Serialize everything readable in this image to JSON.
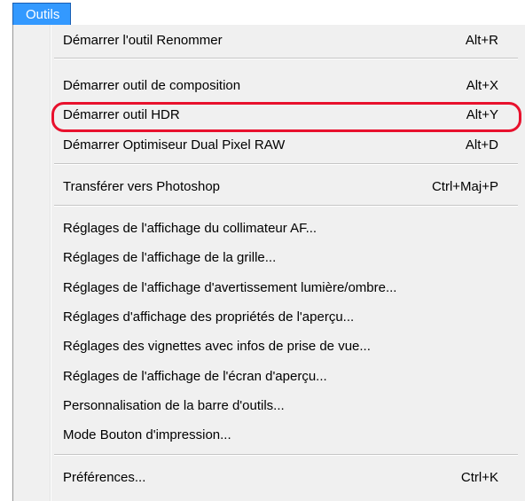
{
  "menubar": {
    "title": "Outils"
  },
  "menu": {
    "items": [
      {
        "label": "Démarrer l'outil Renommer",
        "shortcut": "Alt+R"
      },
      {
        "label": "Démarrer outil de composition",
        "shortcut": "Alt+X"
      },
      {
        "label": "Démarrer outil HDR",
        "shortcut": "Alt+Y"
      },
      {
        "label": "Démarrer Optimiseur Dual Pixel RAW",
        "shortcut": "Alt+D"
      },
      {
        "label": "Transférer vers Photoshop",
        "shortcut": "Ctrl+Maj+P"
      },
      {
        "label": "Réglages de l'affichage du collimateur AF..."
      },
      {
        "label": "Réglages de l'affichage de la grille..."
      },
      {
        "label": "Réglages de l'affichage d'avertissement lumière/ombre..."
      },
      {
        "label": "Réglages d'affichage des propriétés de l'aperçu..."
      },
      {
        "label": "Réglages des vignettes avec infos de prise de vue..."
      },
      {
        "label": "Réglages de l'affichage de l'écran d'aperçu..."
      },
      {
        "label": "Personnalisation de la barre d'outils..."
      },
      {
        "label": "Mode Bouton d'impression..."
      },
      {
        "label": "Préférences...",
        "shortcut": "Ctrl+K"
      }
    ]
  },
  "annotation": {
    "highlighted_item": "Démarrer outil HDR",
    "color": "#e8112d"
  },
  "colors": {
    "menu_background": "#f0f0f0",
    "menu_title_background": "#3399ff",
    "menu_title_text": "#ffffff"
  }
}
